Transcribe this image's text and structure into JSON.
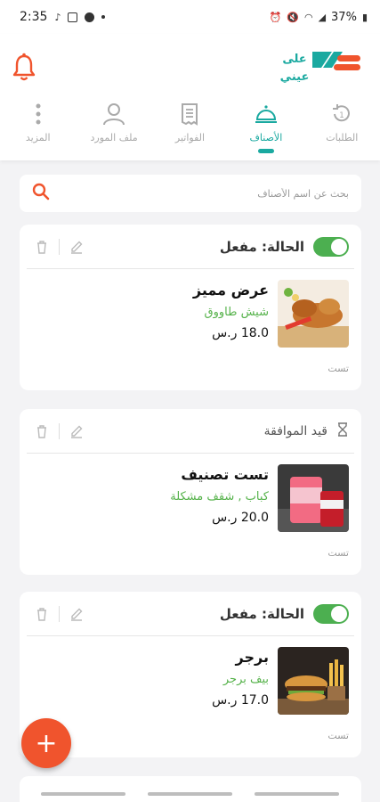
{
  "status_bar": {
    "time": "2:35",
    "battery": "37%"
  },
  "nav": {
    "tabs": [
      {
        "label": "الطلبات",
        "icon": "orders-icon",
        "active": false
      },
      {
        "label": "الأصناف",
        "icon": "cloche-icon",
        "active": true
      },
      {
        "label": "الفواتير",
        "icon": "invoice-icon",
        "active": false
      },
      {
        "label": "ملف المورد",
        "icon": "user-icon",
        "active": false
      },
      {
        "label": "المزيد",
        "icon": "more-icon",
        "active": false
      }
    ]
  },
  "logo": {
    "text_line1": "على",
    "text_line2": "عيني"
  },
  "search": {
    "placeholder": "بحث عن اسم الأصناف"
  },
  "cards": [
    {
      "status": "الحالة: مفعل",
      "name": "عرض مميز",
      "category": "شيش طاووق",
      "price": "18.0 ر.س",
      "note": "تست"
    },
    {
      "status": "قيد الموافقة",
      "name": "تست تصنيف",
      "category": "كباب , شقف مشكلة",
      "price": "20.0 ر.س",
      "note": "تست"
    },
    {
      "status": "الحالة: مفعل",
      "name": "برجر",
      "category": "بيف برجر",
      "price": "17.0 ر.س",
      "note": "تست"
    }
  ],
  "colors": {
    "accent": "#1aa9a0",
    "brand_orange": "#f0542d",
    "active_green": "#4caf50",
    "category_green": "#55b24a"
  }
}
